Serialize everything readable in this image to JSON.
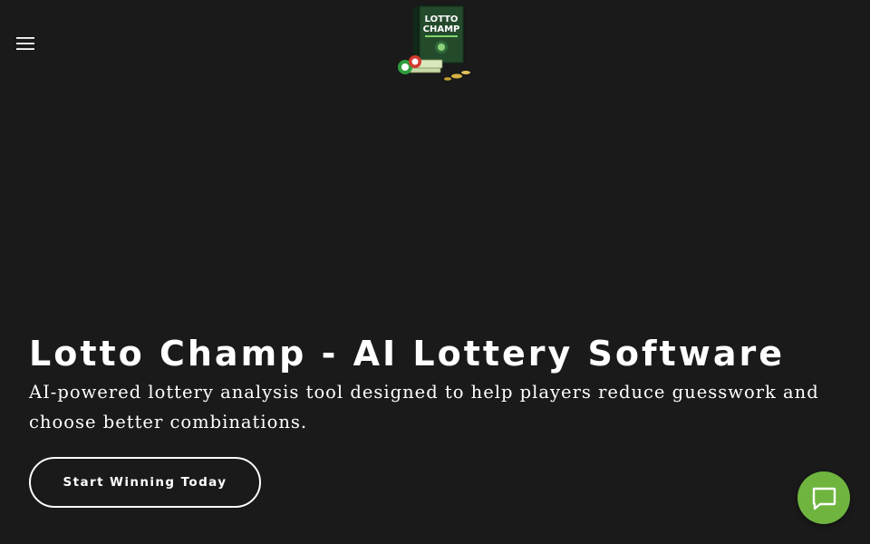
{
  "header": {
    "menu_icon": "hamburger-menu-icon",
    "logo": {
      "icon": "lotto-champ-product-box-logo",
      "text_line1": "LOTTO",
      "text_line2": "CHAMP"
    }
  },
  "hero": {
    "title": "Lotto Champ - AI Lottery Software",
    "subtitle": "AI-powered lottery analysis tool designed to help players reduce guesswork and choose better combinations.",
    "cta_label": "Start Winning Today"
  },
  "chat": {
    "icon": "chat-bubble-icon",
    "color": "#6fb43f"
  },
  "colors": {
    "background": "#1a1a1a",
    "text": "#ffffff",
    "chat_accent": "#6fb43f"
  }
}
